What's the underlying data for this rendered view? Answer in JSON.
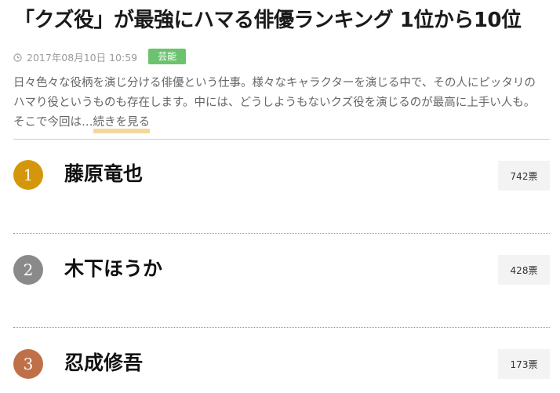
{
  "article": {
    "title": "「クズ役」が最強にハマる俳優ランキング 1位から10位",
    "date": "2017年08月10日 10:59",
    "category": "芸能",
    "description": "日々色々な役柄を演じ分ける俳優という仕事。様々なキャラクターを演じる中で、その人にピッタリのハマり役というものも存在します。中には、どうしようもないクズ役を演じるのが最高に上手い人も。 そこで今回は…",
    "read_more": "続きを見る"
  },
  "ranking": [
    {
      "rank": "1",
      "name": "藤原竜也",
      "votes": "742票",
      "color": "#d4970b"
    },
    {
      "rank": "2",
      "name": "木下ほうか",
      "votes": "428票",
      "color": "#8a8a8a"
    },
    {
      "rank": "3",
      "name": "忍成修吾",
      "votes": "173票",
      "color": "#c07048"
    }
  ],
  "icons": {
    "date": "clock-icon"
  }
}
